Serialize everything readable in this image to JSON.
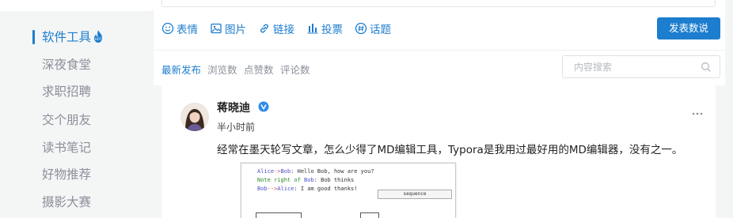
{
  "sidebar": {
    "items": [
      {
        "label": "软件工具",
        "active": true,
        "hot": true
      },
      {
        "label": "深夜食堂"
      },
      {
        "label": "求职招聘"
      },
      {
        "label": "交个朋友"
      },
      {
        "label": "读书笔记"
      },
      {
        "label": "好物推荐"
      },
      {
        "label": "摄影大赛"
      }
    ]
  },
  "composer": {
    "tools": [
      {
        "icon": "emoji-icon",
        "label": "表情"
      },
      {
        "icon": "image-icon",
        "label": "图片"
      },
      {
        "icon": "link-icon",
        "label": "链接"
      },
      {
        "icon": "poll-icon",
        "label": "投票"
      },
      {
        "icon": "topic-icon",
        "label": "话题"
      }
    ],
    "post_label": "发表数说"
  },
  "sort_tabs": [
    "最新发布",
    "浏览数",
    "点赞数",
    "评论数"
  ],
  "search": {
    "placeholder": "内容搜索"
  },
  "post": {
    "author": "蒋晓迪",
    "time": "半小时前",
    "text": "经常在墨天轮写文章，怎么少得了MD编辑工具，Typora是我用过最好用的MD编辑器，没有之一。",
    "embed": {
      "lines": [
        {
          "a": "Alice",
          "op": "->",
          "b": "Bob",
          "rest": ": Hello Bob, how are you?"
        },
        {
          "a": "Note right of",
          "b": "Bob",
          "rest": ": Bob thinks"
        },
        {
          "a": "Bob",
          "op": "-->",
          "b": "Alice",
          "rest": ": I am good thanks!"
        }
      ],
      "label": "sequence"
    }
  },
  "colors": {
    "accent": "#1d7dce",
    "verified": "#2f8ae8"
  }
}
